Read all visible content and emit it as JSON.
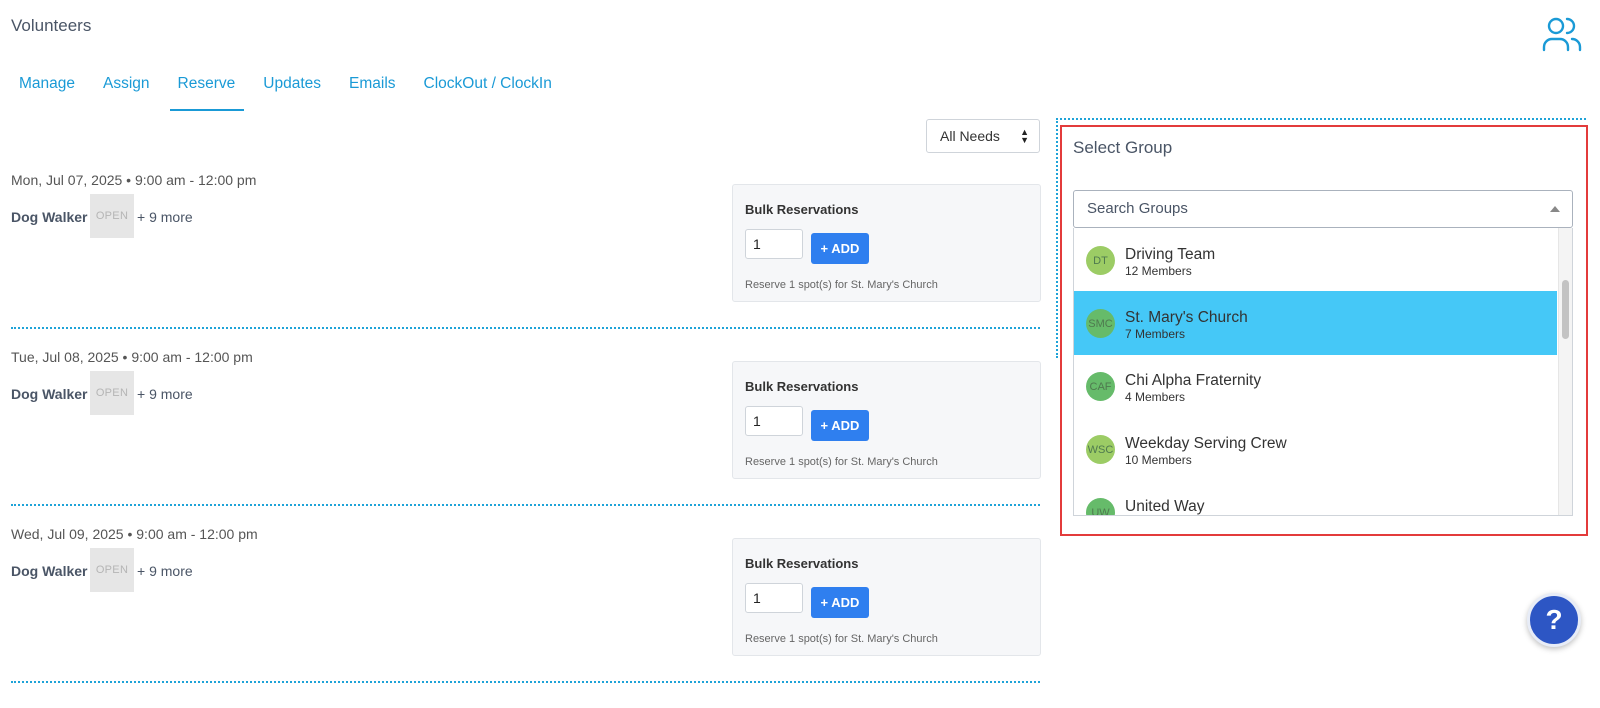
{
  "page": {
    "title": "Volunteers"
  },
  "tabs": [
    {
      "label": "Manage"
    },
    {
      "label": "Assign"
    },
    {
      "label": "Reserve",
      "active": true
    },
    {
      "label": "Updates"
    },
    {
      "label": "Emails"
    },
    {
      "label": "ClockOut / ClockIn"
    }
  ],
  "filter": {
    "selected": "All Needs"
  },
  "days": [
    {
      "date": "Mon, Jul 07, 2025 • 9:00 am - 12:00 pm",
      "role": "Dog Walker",
      "badge": "OPEN",
      "more": "+ 9 more",
      "bulk": {
        "title": "Bulk Reservations",
        "qty": "1",
        "add_label": "+ ADD",
        "note": "Reserve 1 spot(s) for St. Mary's Church"
      }
    },
    {
      "date": "Tue, Jul 08, 2025 • 9:00 am - 12:00 pm",
      "role": "Dog Walker",
      "badge": "OPEN",
      "more": "+ 9 more",
      "bulk": {
        "title": "Bulk Reservations",
        "qty": "1",
        "add_label": "+ ADD",
        "note": "Reserve 1 spot(s) for St. Mary's Church"
      }
    },
    {
      "date": "Wed, Jul 09, 2025 • 9:00 am - 12:00 pm",
      "role": "Dog Walker",
      "badge": "OPEN",
      "more": "+ 9 more",
      "bulk": {
        "title": "Bulk Reservations",
        "qty": "1",
        "add_label": "+ ADD",
        "note": "Reserve 1 spot(s) for St. Mary's Church"
      }
    }
  ],
  "group_panel": {
    "title": "Select Group",
    "search_placeholder": "Search Groups",
    "groups": [
      {
        "initials": "DT",
        "name": "Driving Team",
        "members": "12 Members",
        "color": "#9ccc65"
      },
      {
        "initials": "SMC",
        "name": "St. Mary's Church",
        "members": "7 Members",
        "color": "#66bb6a",
        "selected": true
      },
      {
        "initials": "CAF",
        "name": "Chi Alpha Fraternity",
        "members": "4 Members",
        "color": "#66bb6a"
      },
      {
        "initials": "WSC",
        "name": "Weekday Serving Crew",
        "members": "10 Members",
        "color": "#9ccc65"
      },
      {
        "initials": "UW",
        "name": "United Way",
        "members": "",
        "color": "#66bb6a"
      }
    ]
  },
  "help": {
    "label": "?"
  },
  "colors": {
    "accent": "#1a9ad6",
    "add_button": "#2f7fef",
    "selected_row": "#45c8f7",
    "highlight_border": "#e33b3b"
  }
}
